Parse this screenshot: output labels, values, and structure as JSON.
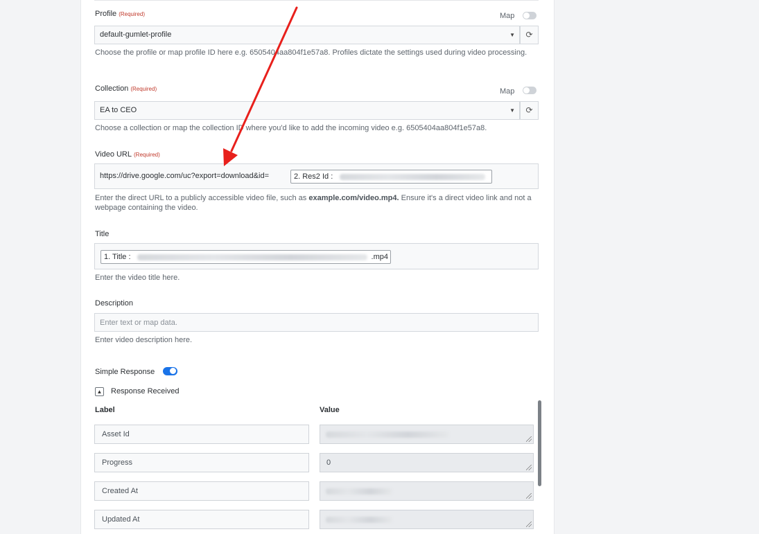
{
  "profile": {
    "label": "Profile",
    "required": "(Required)",
    "map_label": "Map",
    "value": "default-gumlet-profile",
    "help": "Choose the profile or map profile ID here e.g. 6505404aa804f1e57a8. Profiles dictate the settings used during video processing."
  },
  "collection": {
    "label": "Collection",
    "required": "(Required)",
    "map_label": "Map",
    "value": "EA to CEO",
    "help": "Choose a collection or map the collection ID where you'd like to add the incoming video e.g. 6505404aa804f1e57a8."
  },
  "video_url": {
    "label": "Video URL",
    "required": "(Required)",
    "prefix_text": "https://drive.google.com/uc?export=download&id=",
    "chip": "2. Res2 Id :",
    "help_before": "Enter the direct URL to a publicly accessible video file, such as ",
    "help_bold": "example.com/video.mp4.",
    "help_after": " Ensure it's a direct video link and not a webpage containing the video."
  },
  "title": {
    "label": "Title",
    "chip_prefix": "1. Title :",
    "chip_suffix": ".mp4",
    "help": "Enter the video title here."
  },
  "description": {
    "label": "Description",
    "placeholder": "Enter text or map data.",
    "help": "Enter video description here."
  },
  "simple_response": {
    "label": "Simple Response",
    "enabled": true
  },
  "response_received": {
    "label": "Response Received",
    "col_label": "Label",
    "col_value": "Value",
    "rows": [
      {
        "label": "Asset Id",
        "value": ""
      },
      {
        "label": "Progress",
        "value": "0"
      },
      {
        "label": "Created At",
        "value": ""
      },
      {
        "label": "Updated At",
        "value": ""
      }
    ]
  },
  "colors": {
    "accent": "#1a73e8",
    "arrow": "#e8201c",
    "required": "#c0392b"
  }
}
